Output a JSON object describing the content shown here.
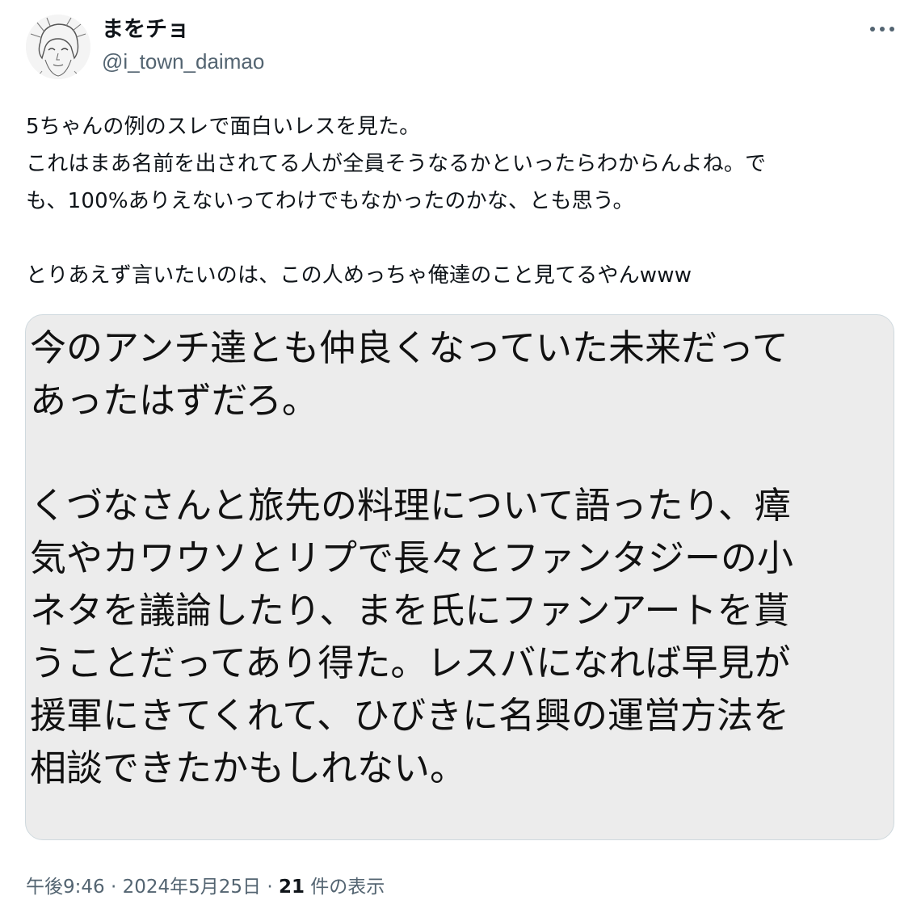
{
  "author": {
    "display_name": "まをチョ",
    "handle": "@i_town_daimao",
    "avatar_icon": "manga-portrait-avatar"
  },
  "more_icon": "more-horizontal-icon",
  "tweet": {
    "lines": [
      "5ちゃんの例のスレで面白いレスを見た。",
      "これはまあ名前を出されてる人が全員そうなるかといったらわからんよね。で",
      "も、100%ありえないってわけでもなかったのかな、とも思う。",
      "",
      "とりあえず言いたいのは、この人めっちゃ俺達のこと見てるやんwww"
    ]
  },
  "media": {
    "lines": [
      "今のアンチ達とも仲良くなっていた未来だって",
      "あったはずだろ。",
      "",
      "くづなさんと旅先の料理について語ったり、瘴",
      "気やカワウソとリプで長々とファンタジーの小",
      "ネタを議論したり、まを氏にファンアートを貰",
      "うことだってあり得た。レスバになれば早見が",
      "援軍にきてくれて、ひびきに名興の運営方法を",
      "相談できたかもしれない。"
    ]
  },
  "meta": {
    "time": "午後9:46",
    "separator": " · ",
    "date": "2024年5月25日",
    "views_count": "21",
    "views_label": " 件の表示"
  }
}
